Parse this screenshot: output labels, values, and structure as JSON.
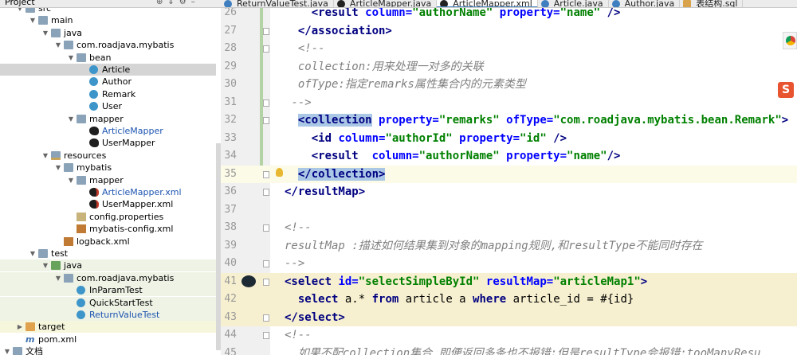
{
  "project_panel": {
    "title": "Project",
    "tree": [
      {
        "label": "src",
        "depth": 1,
        "expanded": true,
        "icon": "folder-icon"
      },
      {
        "label": "main",
        "depth": 2,
        "expanded": true,
        "icon": "folder-icon"
      },
      {
        "label": "java",
        "depth": 3,
        "expanded": true,
        "icon": "source-folder-icon"
      },
      {
        "label": "com.roadjava.mybatis",
        "depth": 4,
        "expanded": true,
        "icon": "package-icon"
      },
      {
        "label": "bean",
        "depth": 5,
        "expanded": true,
        "icon": "package-icon"
      },
      {
        "label": "Article",
        "depth": 6,
        "icon": "class-icon",
        "selected": true
      },
      {
        "label": "Author",
        "depth": 6,
        "icon": "class-icon"
      },
      {
        "label": "Remark",
        "depth": 6,
        "icon": "class-icon"
      },
      {
        "label": "User",
        "depth": 6,
        "icon": "class-icon"
      },
      {
        "label": "mapper",
        "depth": 5,
        "expanded": true,
        "icon": "package-icon"
      },
      {
        "label": "ArticleMapper",
        "depth": 6,
        "icon": "mybatis-interface-icon",
        "blue": true
      },
      {
        "label": "UserMapper",
        "depth": 6,
        "icon": "mybatis-interface-icon"
      },
      {
        "label": "resources",
        "depth": 3,
        "expanded": true,
        "icon": "resources-folder-icon"
      },
      {
        "label": "mybatis",
        "depth": 4,
        "expanded": true,
        "icon": "folder-icon"
      },
      {
        "label": "mapper",
        "depth": 5,
        "expanded": true,
        "icon": "folder-icon"
      },
      {
        "label": "ArticleMapper.xml",
        "depth": 6,
        "icon": "mybatis-xml-icon",
        "blue": true
      },
      {
        "label": "UserMapper.xml",
        "depth": 6,
        "icon": "mybatis-xml-icon"
      },
      {
        "label": "config.properties",
        "depth": 5,
        "icon": "properties-file-icon"
      },
      {
        "label": "mybatis-config.xml",
        "depth": 5,
        "icon": "xml-file-icon"
      },
      {
        "label": "logback.xml",
        "depth": 4,
        "icon": "xml-file-icon"
      },
      {
        "label": "test",
        "depth": 2,
        "expanded": true,
        "icon": "folder-icon"
      },
      {
        "label": "java",
        "depth": 3,
        "expanded": true,
        "icon": "test-folder-icon",
        "bg": "test"
      },
      {
        "label": "com.roadjava.mybatis",
        "depth": 4,
        "expanded": true,
        "icon": "package-icon",
        "bg": "test"
      },
      {
        "label": "InParamTest",
        "depth": 5,
        "icon": "class-icon",
        "bg": "test"
      },
      {
        "label": "QuickStartTest",
        "depth": 5,
        "icon": "class-icon",
        "bg": "test"
      },
      {
        "label": "ReturnValueTest",
        "depth": 5,
        "icon": "class-icon",
        "bg": "test",
        "blue": true
      },
      {
        "label": "target",
        "depth": 1,
        "expanded": false,
        "icon": "excluded-folder-icon",
        "bg": "target"
      },
      {
        "label": "pom.xml",
        "depth": 1,
        "icon": "maven-file-icon"
      },
      {
        "label": "文档",
        "depth": 0,
        "expanded": true,
        "icon": "folder-icon"
      }
    ]
  },
  "tabs": [
    {
      "label": "ReturnValueTest.java",
      "icon": "java-class-icon"
    },
    {
      "label": "ArticleMapper.java",
      "icon": "mybatis-interface-icon"
    },
    {
      "label": "ArticleMapper.xml",
      "icon": "mybatis-xml-icon",
      "active": true
    },
    {
      "label": "Article.java",
      "icon": "java-class-icon"
    },
    {
      "label": "Author.java",
      "icon": "java-class-icon"
    },
    {
      "label": "表结构.sql",
      "icon": "sql-file-icon"
    }
  ],
  "editor": {
    "lines": [
      {
        "num": "26",
        "fold": false,
        "tokens": [
          {
            "t": "    ",
            "c": "plain"
          },
          {
            "t": "<result ",
            "c": "tag"
          },
          {
            "t": "column=",
            "c": "attr"
          },
          {
            "t": "\"authorName\" ",
            "c": "val"
          },
          {
            "t": "property=",
            "c": "attr"
          },
          {
            "t": "\"name\"",
            "c": "val"
          },
          {
            "t": " />",
            "c": "tag"
          }
        ]
      },
      {
        "num": "27",
        "fold": true,
        "tokens": [
          {
            "t": "  ",
            "c": "plain"
          },
          {
            "t": "</association>",
            "c": "tag"
          }
        ]
      },
      {
        "num": "28",
        "fold": true,
        "tokens": [
          {
            "t": "  ",
            "c": "plain"
          },
          {
            "t": "<!--",
            "c": "cmt"
          }
        ]
      },
      {
        "num": "29",
        "fold": false,
        "tokens": [
          {
            "t": "  ",
            "c": "plain"
          },
          {
            "t": "collection:用来处理一对多的关联",
            "c": "cmt"
          }
        ]
      },
      {
        "num": "30",
        "fold": false,
        "tokens": [
          {
            "t": "  ",
            "c": "plain"
          },
          {
            "t": "ofType:指定remarks属性集合内的元素类型",
            "c": "cmt"
          }
        ]
      },
      {
        "num": "31",
        "fold": true,
        "tokens": [
          {
            "t": " ",
            "c": "plain"
          },
          {
            "t": "-->",
            "c": "cmt"
          }
        ]
      },
      {
        "num": "32",
        "fold": true,
        "tokens": [
          {
            "t": "  ",
            "c": "plain"
          },
          {
            "t": "<collection",
            "c": "tag",
            "match": true
          },
          {
            "t": " property=",
            "c": "attr"
          },
          {
            "t": "\"remarks\" ",
            "c": "val"
          },
          {
            "t": "ofType=",
            "c": "attr"
          },
          {
            "t": "\"com.roadjava.mybatis.bean.Remark\"",
            "c": "val"
          },
          {
            "t": ">",
            "c": "tag"
          }
        ]
      },
      {
        "num": "33",
        "fold": false,
        "tokens": [
          {
            "t": "    ",
            "c": "plain"
          },
          {
            "t": "<id ",
            "c": "tag"
          },
          {
            "t": "column=",
            "c": "attr"
          },
          {
            "t": "\"authorId\" ",
            "c": "val"
          },
          {
            "t": "property=",
            "c": "attr"
          },
          {
            "t": "\"id\"",
            "c": "val"
          },
          {
            "t": " />",
            "c": "tag"
          }
        ]
      },
      {
        "num": "34",
        "fold": false,
        "tokens": [
          {
            "t": "    ",
            "c": "plain"
          },
          {
            "t": "<result  ",
            "c": "tag"
          },
          {
            "t": "column=",
            "c": "attr"
          },
          {
            "t": "\"authorName\" ",
            "c": "val"
          },
          {
            "t": "property=",
            "c": "attr"
          },
          {
            "t": "\"name\"",
            "c": "val"
          },
          {
            "t": "/>",
            "c": "tag"
          }
        ]
      },
      {
        "num": "35",
        "fold": true,
        "current": true,
        "bulb": true,
        "tokens": [
          {
            "t": "  ",
            "c": "plain"
          },
          {
            "t": "</collection>",
            "c": "tag",
            "match": true
          }
        ]
      },
      {
        "num": "36",
        "fold": true,
        "tokens": [
          {
            "t": "</resultMap>",
            "c": "tag"
          }
        ]
      },
      {
        "num": "37",
        "fold": false,
        "tokens": []
      },
      {
        "num": "38",
        "fold": true,
        "tokens": [
          {
            "t": "<!--",
            "c": "cmt"
          }
        ]
      },
      {
        "num": "39",
        "fold": false,
        "tokens": [
          {
            "t": "resultMap :描述如何结果集到对象的mapping规则,和resultType不能同时存在",
            "c": "cmt"
          }
        ]
      },
      {
        "num": "40",
        "fold": true,
        "tokens": [
          {
            "t": "-->",
            "c": "cmt"
          }
        ]
      },
      {
        "num": "41",
        "fold": true,
        "hl": true,
        "gutter_icon": "mybatis-bird-icon",
        "tokens": [
          {
            "t": "<select ",
            "c": "tag"
          },
          {
            "t": "id=",
            "c": "attr"
          },
          {
            "t": "\"selectSimpleById\" ",
            "c": "val"
          },
          {
            "t": "resultMap=",
            "c": "attr"
          },
          {
            "t": "\"articleMap1\"",
            "c": "val"
          },
          {
            "t": ">",
            "c": "tag"
          }
        ]
      },
      {
        "num": "42",
        "fold": false,
        "hl": true,
        "tokens": [
          {
            "t": "  ",
            "c": "plain"
          },
          {
            "t": "select ",
            "c": "kw"
          },
          {
            "t": "a.* ",
            "c": "plain"
          },
          {
            "t": "from ",
            "c": "kw"
          },
          {
            "t": "article a ",
            "c": "plain"
          },
          {
            "t": "where ",
            "c": "kw"
          },
          {
            "t": "article_id = #{id}",
            "c": "plain"
          }
        ]
      },
      {
        "num": "43",
        "fold": true,
        "hl": true,
        "tokens": [
          {
            "t": "</select>",
            "c": "tag"
          }
        ]
      },
      {
        "num": "44",
        "fold": true,
        "tokens": [
          {
            "t": "<!--",
            "c": "cmt"
          }
        ]
      },
      {
        "num": "45",
        "fold": false,
        "tokens": [
          {
            "t": "  如果不配collection集合,即便返回多条也不报错;但是resultType会报错:tooManyResu",
            "c": "cmt"
          }
        ]
      }
    ]
  },
  "floating": {
    "sogou_label": "S"
  }
}
